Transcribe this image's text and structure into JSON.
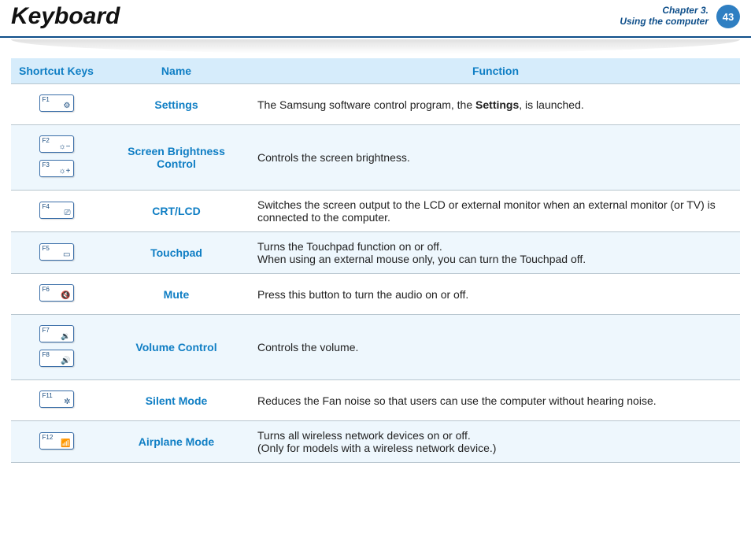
{
  "header": {
    "title": "Keyboard",
    "chapter_line1": "Chapter 3.",
    "chapter_line2": "Using the computer",
    "page_number": "43"
  },
  "table": {
    "headers": {
      "shortcut": "Shortcut Keys",
      "name": "Name",
      "function": "Function"
    },
    "rows": [
      {
        "keys": [
          {
            "fn": "F1",
            "icon": "⚙"
          }
        ],
        "name": "Settings",
        "function_pre": "The Samsung software control program, the ",
        "function_bold": "Settings",
        "function_post": ", is launched.",
        "alt": false
      },
      {
        "keys": [
          {
            "fn": "F2",
            "icon": "☼−"
          },
          {
            "fn": "F3",
            "icon": "☼+"
          }
        ],
        "name": "Screen Brightness Control",
        "function": "Controls the screen brightness.",
        "alt": true
      },
      {
        "keys": [
          {
            "fn": "F4",
            "icon": "⎚"
          }
        ],
        "name": "CRT/LCD",
        "function": "Switches the screen output to the LCD or external monitor when an external monitor (or TV) is connected to the computer.",
        "alt": false
      },
      {
        "keys": [
          {
            "fn": "F5",
            "icon": "▭"
          }
        ],
        "name": "Touchpad",
        "function_line1": "Turns the Touchpad function on or off.",
        "function_line2": "When using an external mouse only, you can turn the Touchpad off.",
        "alt": true
      },
      {
        "keys": [
          {
            "fn": "F6",
            "icon": "🔇"
          }
        ],
        "name": "Mute",
        "function": "Press this button to turn the audio on or off.",
        "alt": false
      },
      {
        "keys": [
          {
            "fn": "F7",
            "icon": "🔉"
          },
          {
            "fn": "F8",
            "icon": "🔊"
          }
        ],
        "name": "Volume Control",
        "function": "Controls the volume.",
        "alt": true
      },
      {
        "keys": [
          {
            "fn": "F11",
            "icon": "✲"
          }
        ],
        "name": "Silent Mode",
        "function": "Reduces the Fan noise so that users can use the computer without hearing noise.",
        "alt": false
      },
      {
        "keys": [
          {
            "fn": "F12",
            "icon": "📶"
          }
        ],
        "name": "Airplane Mode",
        "function_line1": "Turns all wireless network devices on or off.",
        "function_line2": "(Only for models with a wireless network device.)",
        "alt": true
      }
    ]
  }
}
